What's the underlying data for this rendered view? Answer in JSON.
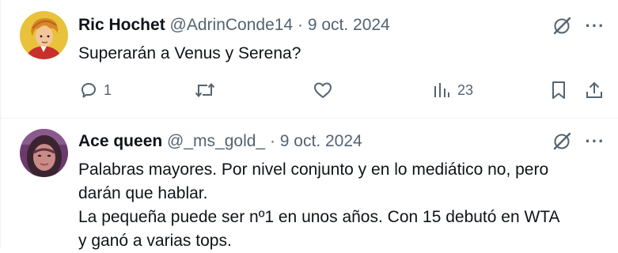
{
  "tweets": [
    {
      "name": "Ric Hochet",
      "handle": "@AdrinConde14",
      "separator": "·",
      "date": "9 oct. 2024",
      "lines": [
        "Superarán a Venus y Serena?"
      ],
      "replies": "1",
      "views": "23",
      "avatar_colors": {
        "bg": "#e8c23a",
        "hair": "#d9862a",
        "face": "#f2c69a",
        "shirt": "#c8302c"
      }
    },
    {
      "name": "Ace queen",
      "handle": "@_ms_gold_",
      "separator": "·",
      "date": "9 oct. 2024",
      "lines": [
        "Palabras mayores. Por nivel conjunto y en lo mediático no, pero",
        "darán que hablar.",
        "La pequeña puede ser nº1 en unos años. Con 15 debutó en WTA",
        "y ganó a varias tops."
      ],
      "avatar_colors": {
        "bg": "#6b3a6e",
        "hair": "#3b2430",
        "face": "#c98b86"
      }
    }
  ],
  "more_glyph": "···",
  "icons": [
    "grok-icon",
    "more-icon",
    "reply-icon",
    "repost-icon",
    "like-icon",
    "views-icon",
    "bookmark-icon",
    "share-icon"
  ],
  "colors": {
    "text": "#0f1419",
    "secondary": "#536471",
    "divider": "#eff3f4"
  }
}
